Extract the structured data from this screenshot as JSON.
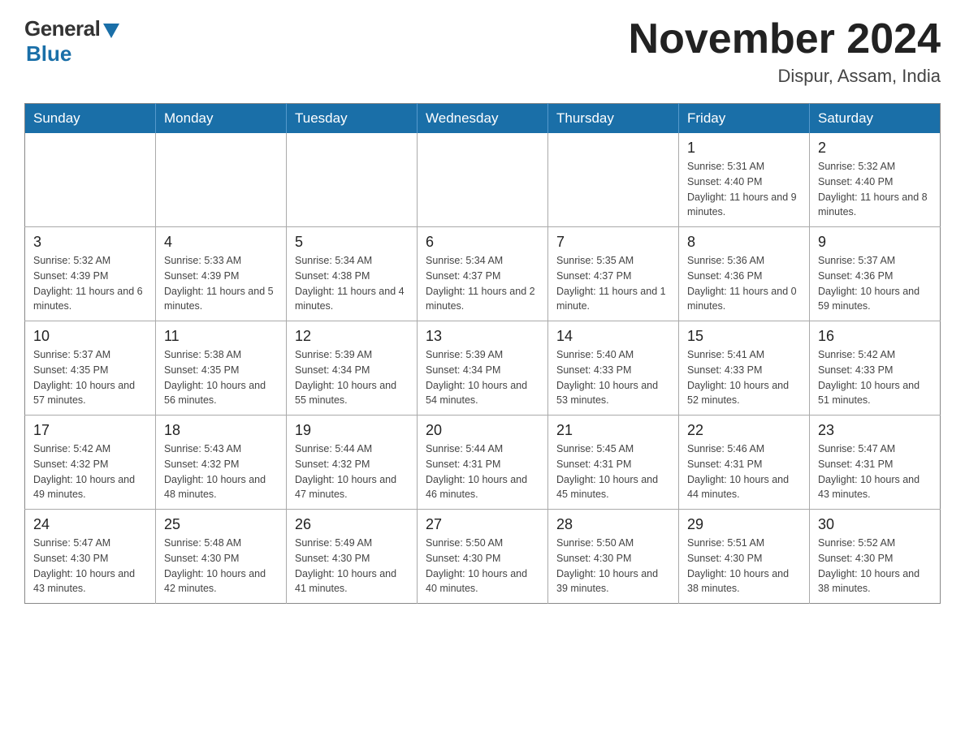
{
  "logo": {
    "general": "General",
    "blue": "Blue"
  },
  "title": "November 2024",
  "location": "Dispur, Assam, India",
  "weekdays": [
    "Sunday",
    "Monday",
    "Tuesday",
    "Wednesday",
    "Thursday",
    "Friday",
    "Saturday"
  ],
  "weeks": [
    [
      {
        "day": "",
        "info": ""
      },
      {
        "day": "",
        "info": ""
      },
      {
        "day": "",
        "info": ""
      },
      {
        "day": "",
        "info": ""
      },
      {
        "day": "",
        "info": ""
      },
      {
        "day": "1",
        "info": "Sunrise: 5:31 AM\nSunset: 4:40 PM\nDaylight: 11 hours and 9 minutes."
      },
      {
        "day": "2",
        "info": "Sunrise: 5:32 AM\nSunset: 4:40 PM\nDaylight: 11 hours and 8 minutes."
      }
    ],
    [
      {
        "day": "3",
        "info": "Sunrise: 5:32 AM\nSunset: 4:39 PM\nDaylight: 11 hours and 6 minutes."
      },
      {
        "day": "4",
        "info": "Sunrise: 5:33 AM\nSunset: 4:39 PM\nDaylight: 11 hours and 5 minutes."
      },
      {
        "day": "5",
        "info": "Sunrise: 5:34 AM\nSunset: 4:38 PM\nDaylight: 11 hours and 4 minutes."
      },
      {
        "day": "6",
        "info": "Sunrise: 5:34 AM\nSunset: 4:37 PM\nDaylight: 11 hours and 2 minutes."
      },
      {
        "day": "7",
        "info": "Sunrise: 5:35 AM\nSunset: 4:37 PM\nDaylight: 11 hours and 1 minute."
      },
      {
        "day": "8",
        "info": "Sunrise: 5:36 AM\nSunset: 4:36 PM\nDaylight: 11 hours and 0 minutes."
      },
      {
        "day": "9",
        "info": "Sunrise: 5:37 AM\nSunset: 4:36 PM\nDaylight: 10 hours and 59 minutes."
      }
    ],
    [
      {
        "day": "10",
        "info": "Sunrise: 5:37 AM\nSunset: 4:35 PM\nDaylight: 10 hours and 57 minutes."
      },
      {
        "day": "11",
        "info": "Sunrise: 5:38 AM\nSunset: 4:35 PM\nDaylight: 10 hours and 56 minutes."
      },
      {
        "day": "12",
        "info": "Sunrise: 5:39 AM\nSunset: 4:34 PM\nDaylight: 10 hours and 55 minutes."
      },
      {
        "day": "13",
        "info": "Sunrise: 5:39 AM\nSunset: 4:34 PM\nDaylight: 10 hours and 54 minutes."
      },
      {
        "day": "14",
        "info": "Sunrise: 5:40 AM\nSunset: 4:33 PM\nDaylight: 10 hours and 53 minutes."
      },
      {
        "day": "15",
        "info": "Sunrise: 5:41 AM\nSunset: 4:33 PM\nDaylight: 10 hours and 52 minutes."
      },
      {
        "day": "16",
        "info": "Sunrise: 5:42 AM\nSunset: 4:33 PM\nDaylight: 10 hours and 51 minutes."
      }
    ],
    [
      {
        "day": "17",
        "info": "Sunrise: 5:42 AM\nSunset: 4:32 PM\nDaylight: 10 hours and 49 minutes."
      },
      {
        "day": "18",
        "info": "Sunrise: 5:43 AM\nSunset: 4:32 PM\nDaylight: 10 hours and 48 minutes."
      },
      {
        "day": "19",
        "info": "Sunrise: 5:44 AM\nSunset: 4:32 PM\nDaylight: 10 hours and 47 minutes."
      },
      {
        "day": "20",
        "info": "Sunrise: 5:44 AM\nSunset: 4:31 PM\nDaylight: 10 hours and 46 minutes."
      },
      {
        "day": "21",
        "info": "Sunrise: 5:45 AM\nSunset: 4:31 PM\nDaylight: 10 hours and 45 minutes."
      },
      {
        "day": "22",
        "info": "Sunrise: 5:46 AM\nSunset: 4:31 PM\nDaylight: 10 hours and 44 minutes."
      },
      {
        "day": "23",
        "info": "Sunrise: 5:47 AM\nSunset: 4:31 PM\nDaylight: 10 hours and 43 minutes."
      }
    ],
    [
      {
        "day": "24",
        "info": "Sunrise: 5:47 AM\nSunset: 4:30 PM\nDaylight: 10 hours and 43 minutes."
      },
      {
        "day": "25",
        "info": "Sunrise: 5:48 AM\nSunset: 4:30 PM\nDaylight: 10 hours and 42 minutes."
      },
      {
        "day": "26",
        "info": "Sunrise: 5:49 AM\nSunset: 4:30 PM\nDaylight: 10 hours and 41 minutes."
      },
      {
        "day": "27",
        "info": "Sunrise: 5:50 AM\nSunset: 4:30 PM\nDaylight: 10 hours and 40 minutes."
      },
      {
        "day": "28",
        "info": "Sunrise: 5:50 AM\nSunset: 4:30 PM\nDaylight: 10 hours and 39 minutes."
      },
      {
        "day": "29",
        "info": "Sunrise: 5:51 AM\nSunset: 4:30 PM\nDaylight: 10 hours and 38 minutes."
      },
      {
        "day": "30",
        "info": "Sunrise: 5:52 AM\nSunset: 4:30 PM\nDaylight: 10 hours and 38 minutes."
      }
    ]
  ]
}
